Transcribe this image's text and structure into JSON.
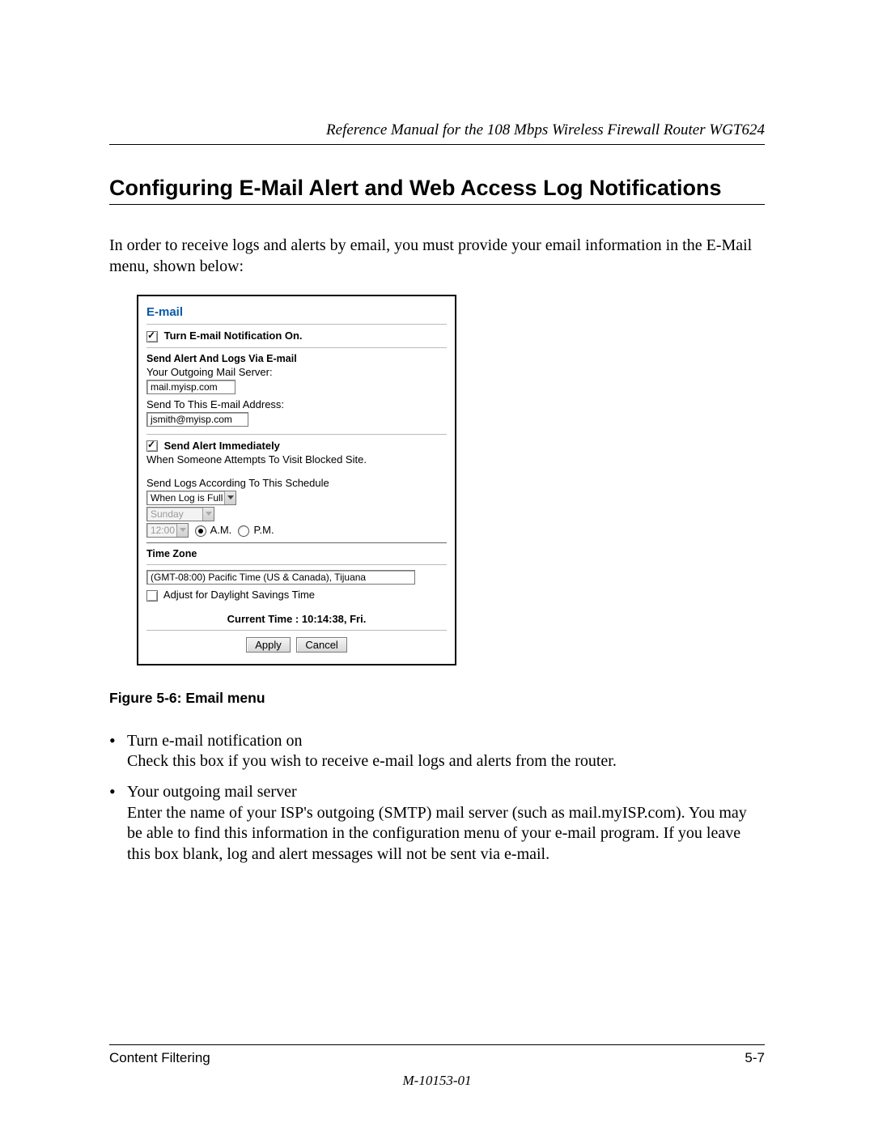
{
  "header": {
    "running_head": "Reference Manual for the 108 Mbps Wireless Firewall Router WGT624"
  },
  "title": "Configuring E-Mail Alert and Web Access Log Notifications",
  "intro": "In order to receive logs and alerts by email, you must provide your email information in the E-Mail menu, shown below:",
  "figure": {
    "panel_title": "E-mail",
    "turn_on_label": "Turn E-mail Notification On.",
    "send_heading": "Send Alert And Logs Via E-mail",
    "outgoing_label": "Your Outgoing Mail Server:",
    "outgoing_value": "mail.myisp.com",
    "sendto_label": "Send To This E-mail Address:",
    "sendto_value": "jsmith@myisp.com",
    "alert_immediate_label": "Send Alert Immediately",
    "alert_desc": "When Someone Attempts To Visit Blocked Site.",
    "schedule_label": "Send Logs According To This Schedule",
    "schedule_value": "When Log is Full",
    "day_value": "Sunday",
    "time_value": "12:00",
    "am_label": "A.M.",
    "pm_label": "P.M.",
    "tz_heading": "Time Zone",
    "tz_value": "(GMT-08:00) Pacific Time (US & Canada), Tijuana",
    "dst_label": "Adjust for Daylight Savings Time",
    "current_time": "Current Time : 10:14:38, Fri.",
    "apply": "Apply",
    "cancel": "Cancel"
  },
  "caption": "Figure 5-6:  Email menu",
  "bullets": [
    {
      "lead": "Turn e-mail notification on",
      "body": "Check this box if you wish to receive e-mail logs and alerts from the router."
    },
    {
      "lead": "Your outgoing mail server",
      "body": "Enter the name of your ISP's outgoing (SMTP) mail server (such as mail.myISP.com). You may be able to find this information in the configuration menu of your e-mail program. If you leave this box blank, log and alert messages will not be sent via e-mail."
    }
  ],
  "footer": {
    "left": "Content Filtering",
    "right": "5-7",
    "docnum": "M-10153-01"
  }
}
